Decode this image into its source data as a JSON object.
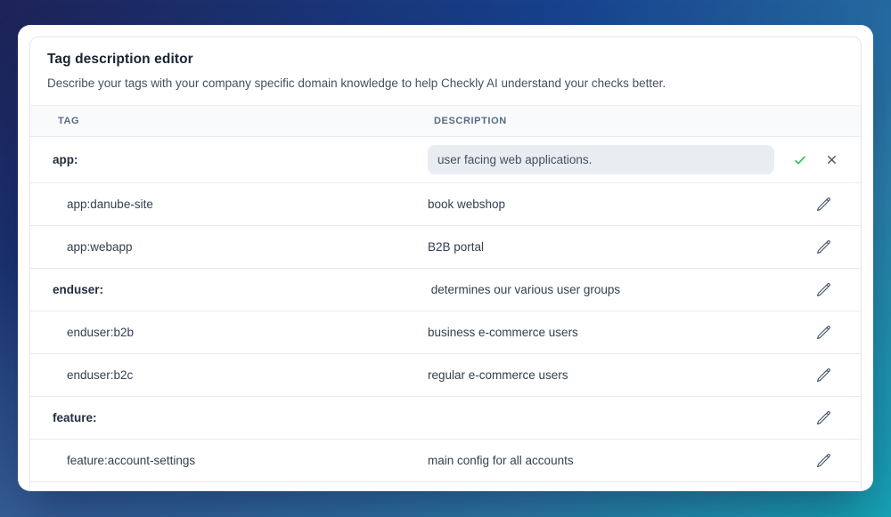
{
  "panel": {
    "title": "Tag description editor",
    "subtitle": "Describe your tags with your company specific domain knowledge to help Checkly AI understand your checks better."
  },
  "table": {
    "columns": {
      "tag": "TAG",
      "description": "DESCRIPTION"
    },
    "rows": [
      {
        "tag": "app:",
        "level": 0,
        "bold": true,
        "editing": true,
        "input_value": "user facing web applications.",
        "actions": [
          "confirm",
          "cancel"
        ]
      },
      {
        "tag": "app:danube-site",
        "level": 1,
        "bold": false,
        "description": "book webshop",
        "actions": [
          "edit"
        ]
      },
      {
        "tag": "app:webapp",
        "level": 1,
        "bold": false,
        "description": "B2B portal",
        "actions": [
          "edit"
        ]
      },
      {
        "tag": "enduser:",
        "level": 0,
        "bold": true,
        "description": " determines our various user groups",
        "actions": [
          "edit"
        ]
      },
      {
        "tag": "enduser:b2b",
        "level": 1,
        "bold": false,
        "description": "business e-commerce users",
        "actions": [
          "edit"
        ]
      },
      {
        "tag": "enduser:b2c",
        "level": 1,
        "bold": false,
        "description": "regular e-commerce users",
        "actions": [
          "edit"
        ]
      },
      {
        "tag": "feature:",
        "level": 0,
        "bold": true,
        "description": "",
        "actions": [
          "edit"
        ]
      },
      {
        "tag": "feature:account-settings",
        "level": 1,
        "bold": false,
        "description": "main config for all accounts",
        "actions": [
          "edit"
        ]
      }
    ]
  },
  "icons": {
    "confirm": "check-icon",
    "cancel": "close-icon",
    "edit": "pencil-icon"
  },
  "colors": {
    "accent_green": "#2bc158",
    "icon_slate": "#475569",
    "input_bg": "#e9edf2",
    "header_bg": "#f8fafc",
    "bg_gradient": [
      "#1e2357",
      "#17418d",
      "#2a7aa8",
      "#15a3b2"
    ]
  }
}
